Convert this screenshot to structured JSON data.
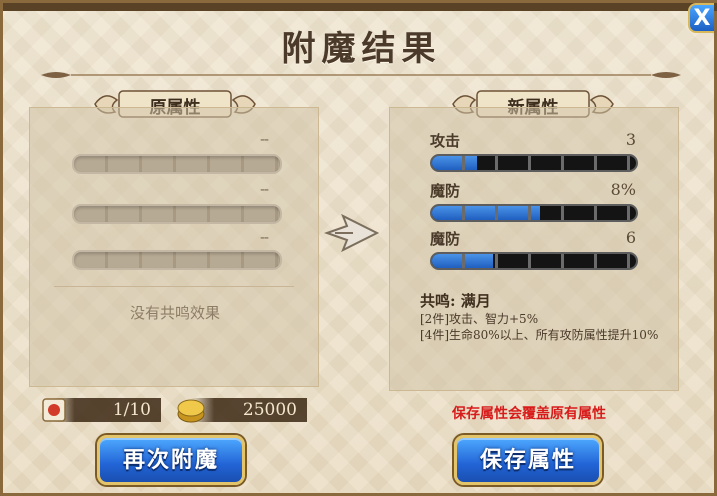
{
  "dialog": {
    "title": "附魔结果",
    "close_label": "X"
  },
  "original": {
    "heading": "原属性",
    "rows": [
      {
        "value": "--"
      },
      {
        "value": "--"
      },
      {
        "value": "--"
      }
    ],
    "resonance_text": "没有共鸣效果"
  },
  "new_attr": {
    "heading": "新属性",
    "stats": [
      {
        "name": "攻击",
        "value": "3",
        "fill": 0.22
      },
      {
        "name": "魔防",
        "value": "8%",
        "fill": 0.53
      },
      {
        "name": "魔防",
        "value": "6",
        "fill": 0.3
      }
    ],
    "resonance_title": "共鸣: 满月",
    "resonance_lines": [
      "[2件]攻击、智力+5%",
      "[4件]生命80%以上、所有攻防属性提升10%"
    ]
  },
  "costs": {
    "scroll_count": "1/10",
    "gold": "25000"
  },
  "warning": "保存属性会覆盖原有属性",
  "buttons": {
    "re_enchant": "再次附魔",
    "save": "保存属性"
  },
  "colors": {
    "bar_fill": "#2f79d9",
    "warning": "#d81b1b",
    "button": "#2264d6"
  }
}
